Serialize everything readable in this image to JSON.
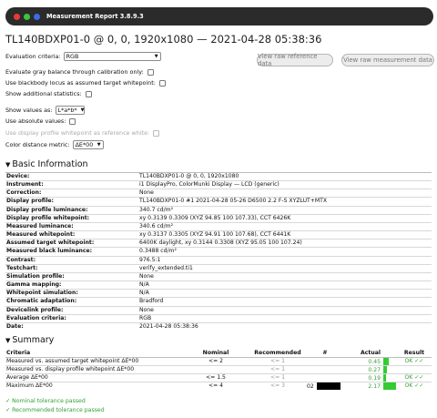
{
  "window": {
    "title": "Measurement Report 3.8.9.3",
    "dot_colors": [
      "#e63b3b",
      "#3bc43b",
      "#3b6be6"
    ]
  },
  "report_title": "TL140BDXP01-0 @ 0, 0, 1920x1080 — 2021-04-28 05:38:36",
  "controls": {
    "evaluation_criteria_label": "Evaluation criteria:",
    "evaluation_criteria_value": "RGB",
    "gray_balance_label": "Evaluate gray balance through calibration only:",
    "blackbody_label": "Use blackbody locus as assumed target whitepoint:",
    "additional_stats_label": "Show additional statistics:",
    "show_values_label": "Show values as:",
    "show_values_value": "L*a*b*",
    "absolute_values_label": "Use absolute values:",
    "display_profile_wp_label": "Use display profile whitepoint as reference white:",
    "color_distance_label": "Color distance metric:",
    "color_distance_value": "ΔE*00"
  },
  "buttons": {
    "view_reference": "View raw reference data",
    "view_measurement": "View raw measurement data"
  },
  "basic_info": {
    "heading": "Basic Information",
    "rows": [
      {
        "k": "Device:",
        "v": "TL140BDXP01-0 @ 0, 0, 1920x1080"
      },
      {
        "k": "Instrument:",
        "v": "i1 DisplayPro, ColorMunki Display — LCD (generic)"
      },
      {
        "k": "Correction:",
        "v": "None"
      },
      {
        "k": "Display profile:",
        "v": "TL140BDXP01-0 #1 2021-04-28 05-26 D6500 2.2 F-S XYZLUT+MTX"
      },
      {
        "k": "Display profile luminance:",
        "v": "340.7 cd/m²"
      },
      {
        "k": "Display profile whitepoint:",
        "v": "xy 0.3139 0.3309 (XYZ 94.85 100 107.33), CCT 6426K"
      },
      {
        "k": "Measured luminance:",
        "v": "340.6 cd/m²"
      },
      {
        "k": "Measured whitepoint:",
        "v": "xy 0.3137 0.3305 (XYZ 94.91 100 107.68), CCT 6441K"
      },
      {
        "k": "Assumed target whitepoint:",
        "v": "6400K daylight, xy 0.3144 0.3308 (XYZ 95.05 100 107.24)"
      },
      {
        "k": "Measured black luminance:",
        "v": "0.3488 cd/m²"
      },
      {
        "k": "Contrast:",
        "v": "976.5:1"
      },
      {
        "k": "Testchart:",
        "v": "verify_extended.ti1"
      },
      {
        "k": "Simulation profile:",
        "v": "None"
      },
      {
        "k": "Gamma mapping:",
        "v": "N/A"
      },
      {
        "k": "Whitepoint simulation:",
        "v": "N/A"
      },
      {
        "k": "Chromatic adaptation:",
        "v": "Bradford"
      },
      {
        "k": "Devicelink profile:",
        "v": "None"
      },
      {
        "k": "Evaluation criteria:",
        "v": "RGB"
      },
      {
        "k": "Date:",
        "v": "2021-04-28 05:38:36"
      }
    ]
  },
  "summary": {
    "heading": "Summary",
    "headers": {
      "criteria": "Criteria",
      "nominal": "Nominal",
      "recommended": "Recommended",
      "num": "#",
      "actual": "Actual",
      "result": "Result"
    },
    "rows": [
      {
        "criteria": "Measured vs. assumed target whitepoint ΔE*00",
        "nominal": "<= 2",
        "recommended": "<= 1",
        "num": "",
        "actual": "0.45",
        "bar_fraction": 0.45,
        "result": "OK ✓✓"
      },
      {
        "criteria": "Measured vs. display profile whitepoint ΔE*00",
        "nominal": "",
        "recommended": "<= 1",
        "num": "",
        "actual": "0.27",
        "bar_fraction": 0.27,
        "result": ""
      },
      {
        "criteria": "Average ΔE*00",
        "nominal": "<= 1.5",
        "recommended": "<= 1",
        "num": "",
        "actual": "0.19",
        "bar_fraction": 0.19,
        "result": "OK ✓✓"
      },
      {
        "criteria": "Maximum ΔE*00",
        "nominal": "<= 4",
        "recommended": "<= 3",
        "num": "02",
        "actual": "2.17",
        "bar_fraction": 1.0,
        "result": "OK ✓✓"
      }
    ]
  },
  "footer": {
    "nominal_passed": "✓ Nominal tolerance passed",
    "recommended_passed": "✓ Recommended tolerance passed"
  }
}
